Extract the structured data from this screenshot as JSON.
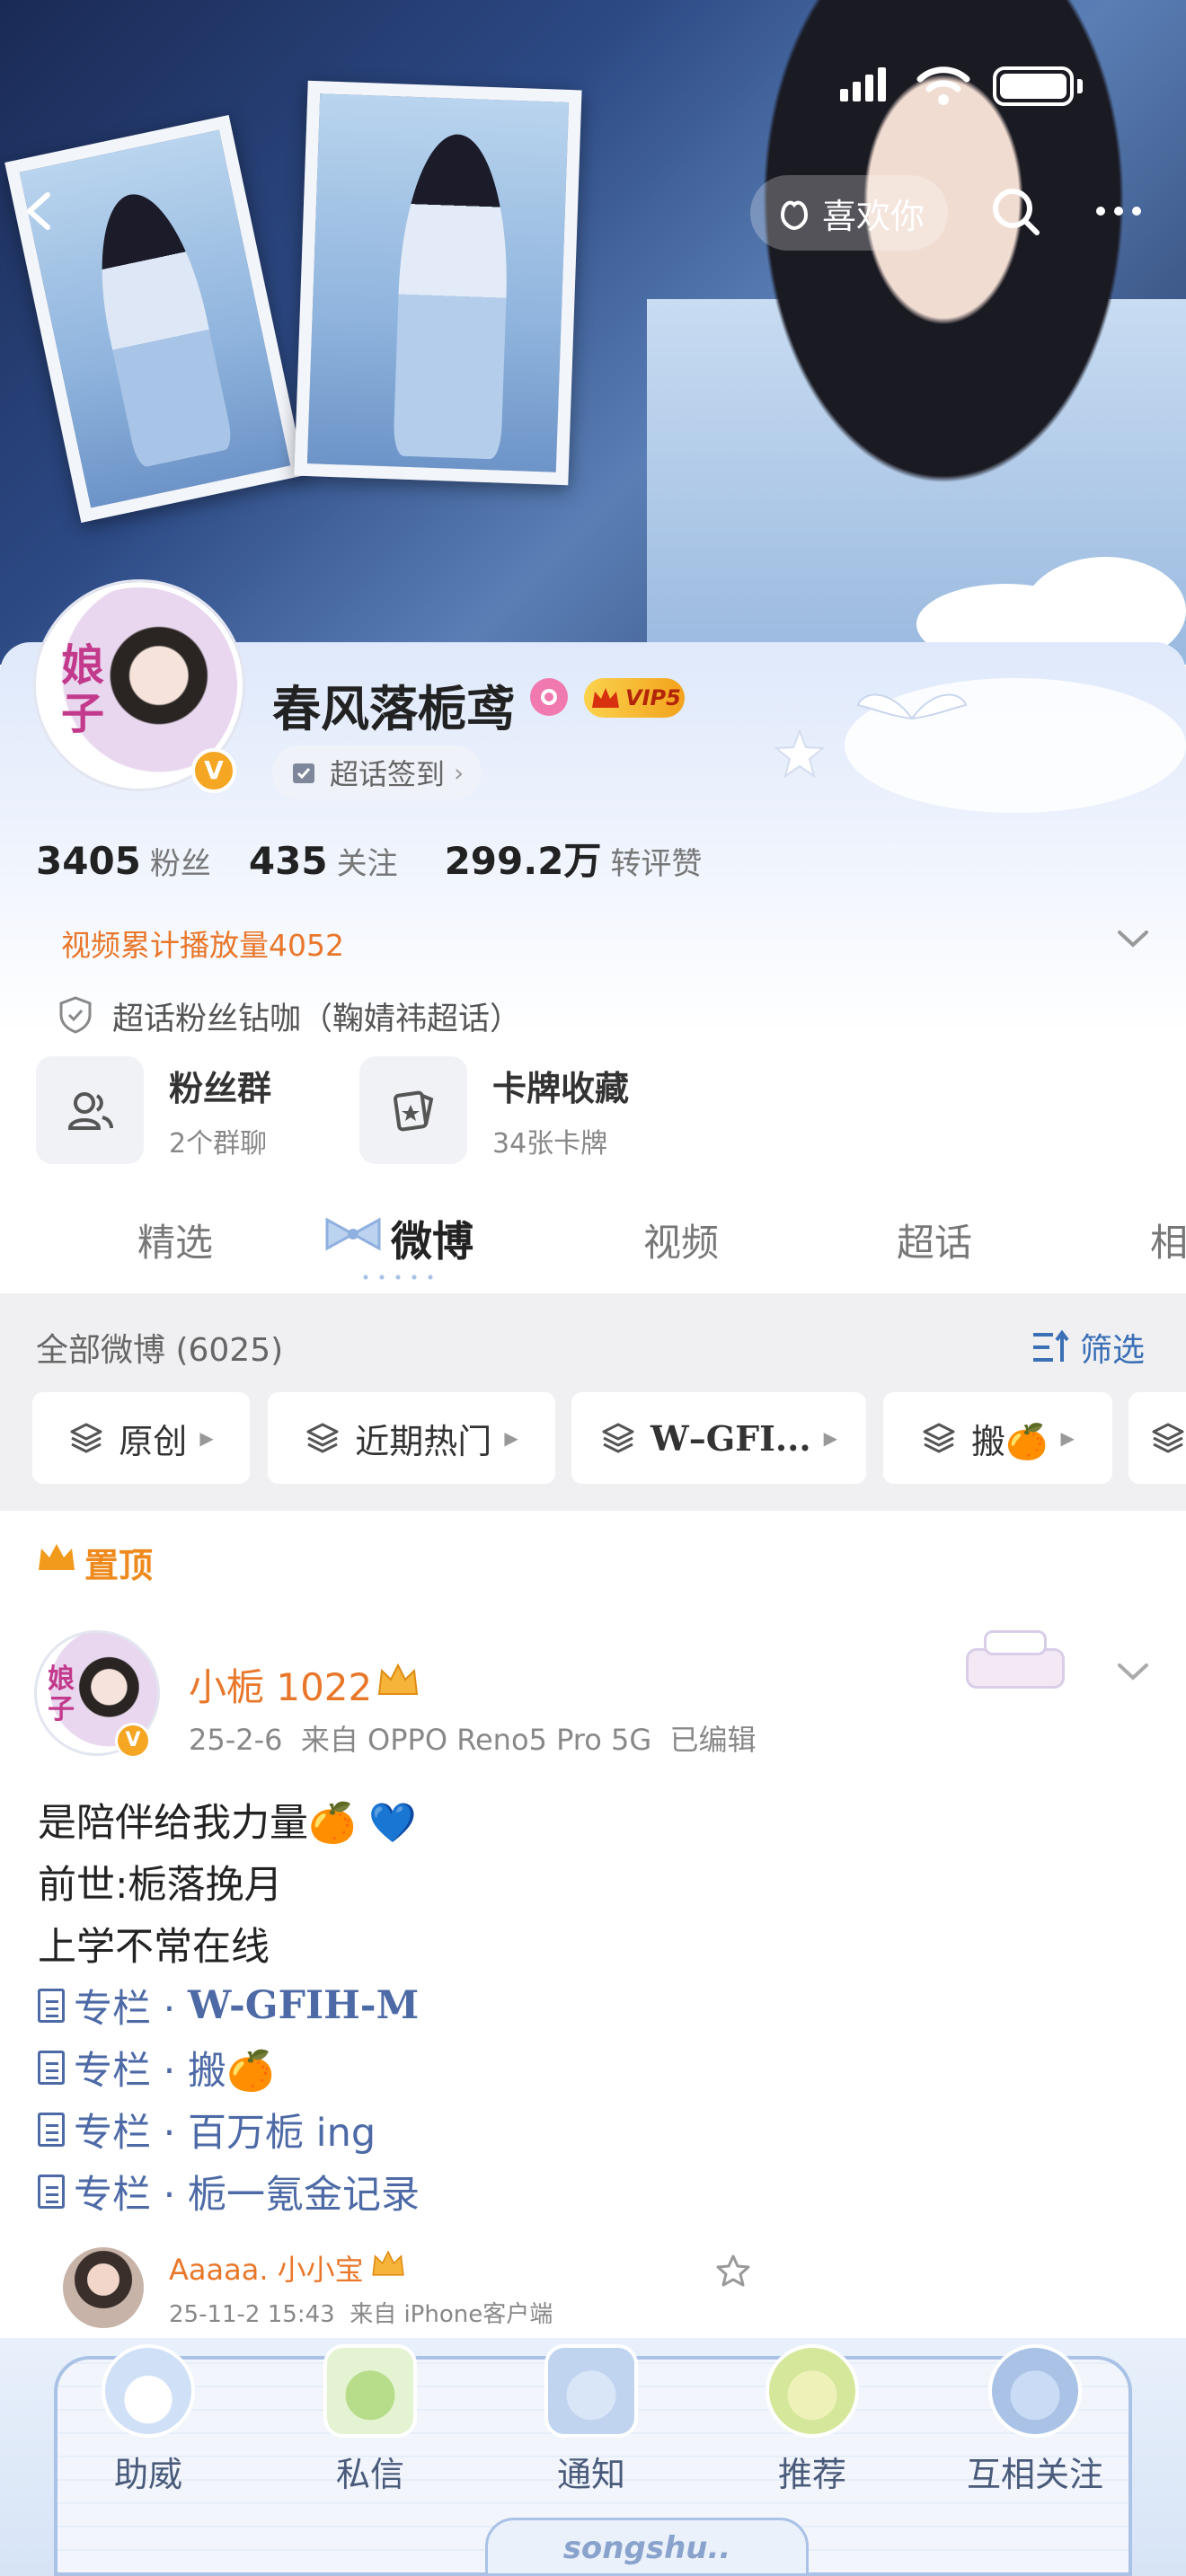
{
  "header": {
    "like_label": "喜欢你"
  },
  "profile": {
    "name": "春风落栀鸢",
    "vip_badge": "VIP5",
    "supertopic_checkin": "超话签到",
    "stats": [
      {
        "value": "3405",
        "label": "粉丝"
      },
      {
        "value": "435",
        "label": "关注"
      },
      {
        "value": "299.2万",
        "label": "转评赞"
      }
    ],
    "video_plays": "视频累计播放量4052",
    "fan_title": "超话粉丝钻咖（鞠婧祎超话）",
    "cards": [
      {
        "title": "粉丝群",
        "sub": "2个群聊"
      },
      {
        "title": "卡牌收藏",
        "sub": "34张卡牌"
      }
    ]
  },
  "tabs": [
    "精选",
    "微博",
    "视频",
    "超话",
    "相"
  ],
  "filter": {
    "all_label": "全部微博 (6025)",
    "filter_label": "筛选",
    "chips": [
      "原创",
      "近期热门",
      "W–GFI...",
      "搬🍊"
    ]
  },
  "pinned_label": "置顶",
  "post": {
    "author": "小栀 1022",
    "meta": "25-2-6  来自 OPPO Reno5 Pro 5G  已编辑",
    "lines": [
      "是陪伴给我力量🍊 💙",
      "前世:栀落挽月",
      "上学不常在线"
    ],
    "columns": [
      {
        "prefix": "专栏 · ",
        "title": "W-GFIH-M"
      },
      {
        "prefix": "专栏 · ",
        "title": "搬🍊"
      },
      {
        "prefix": "专栏 · ",
        "title": "百万栀 ing"
      },
      {
        "prefix": "专栏 · ",
        "title": "栀一氪金记录"
      }
    ]
  },
  "next_post": {
    "author": "Aaaaa. 小小宝",
    "meta": "25-11-2 15:43  来自 iPhone客户端"
  },
  "bottom_nav": [
    "助威",
    "私信",
    "通知",
    "推荐",
    "互相关注"
  ],
  "bottom_sticker_text": "songshu..",
  "colors": {
    "orange": "#e9772a",
    "link_blue": "#4d6aa6",
    "vip_gold": "#f3a21c",
    "tab_active": "#222222"
  }
}
